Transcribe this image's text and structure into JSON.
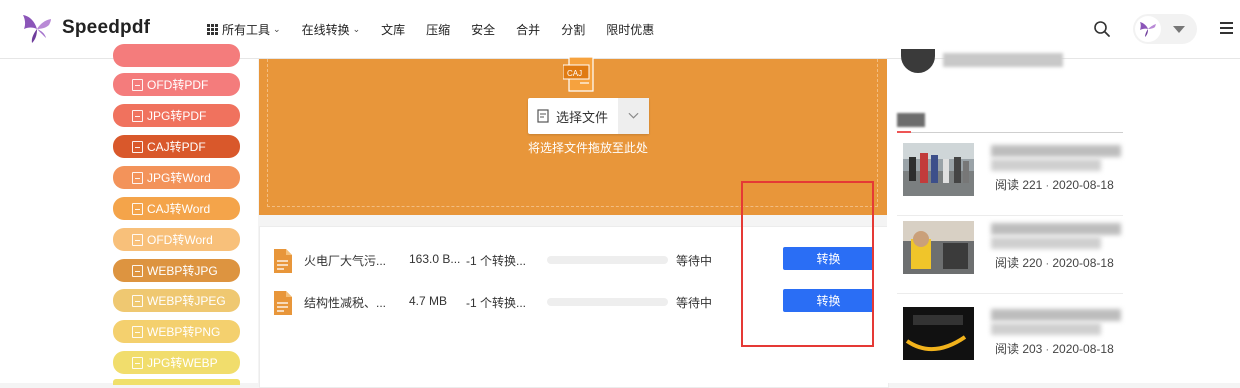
{
  "header": {
    "brand": "Speedpdf",
    "nav": [
      {
        "label": "所有工具",
        "has_grid_icon": true,
        "has_dropdown": true
      },
      {
        "label": "在线转换",
        "has_dropdown": true
      },
      {
        "label": "文库"
      },
      {
        "label": "压缩"
      },
      {
        "label": "安全"
      },
      {
        "label": "合并"
      },
      {
        "label": "分割"
      },
      {
        "label": "限时优惠"
      }
    ],
    "icons": {
      "search": "search-icon",
      "menu": "hamburger-icon",
      "user": "user-avatar"
    }
  },
  "sidebar": {
    "items": [
      {
        "label": "",
        "color": "#f47c7c"
      },
      {
        "label": "OFD转PDF",
        "color": "#f47c7c"
      },
      {
        "label": "JPG转PDF",
        "color": "#f0725e"
      },
      {
        "label": "CAJ转PDF",
        "color": "#d9582b"
      },
      {
        "label": "JPG转Word",
        "color": "#f3935a"
      },
      {
        "label": "CAJ转Word",
        "color": "#f4a44a"
      },
      {
        "label": "OFD转Word",
        "color": "#f8c07a"
      },
      {
        "label": "WEBP转JPG",
        "color": "#dd9440"
      },
      {
        "label": "WEBP转JPEG",
        "color": "#efc871"
      },
      {
        "label": "WEBP转PNG",
        "color": "#f4d06e"
      },
      {
        "label": "JPG转WEBP",
        "color": "#f1dd6c"
      },
      {
        "label": "",
        "color": "#f0e06a"
      }
    ]
  },
  "upload": {
    "badge": "CAJ",
    "choose_label": "选择文件",
    "drop_hint": "将选择文件拖放至此处",
    "bg_color": "#e8963a"
  },
  "files": [
    {
      "name": "火电厂大气污...",
      "size": "163.0 B...",
      "status": "-1 个转换...",
      "progress": 0,
      "wait": "等待中",
      "action": "转换"
    },
    {
      "name": "结构性减税、...",
      "size": "4.7 MB",
      "status": "-1 个转换...",
      "progress": 0,
      "wait": "等待中",
      "action": "转换"
    }
  ],
  "articles": [
    {
      "views": "阅读 221",
      "date": "2020-08-18"
    },
    {
      "views": "阅读 220",
      "date": "2020-08-18"
    },
    {
      "views": "阅读 203",
      "date": "2020-08-18"
    }
  ],
  "colors": {
    "accent": "#2a6ef5",
    "highlight": "#e53935"
  }
}
